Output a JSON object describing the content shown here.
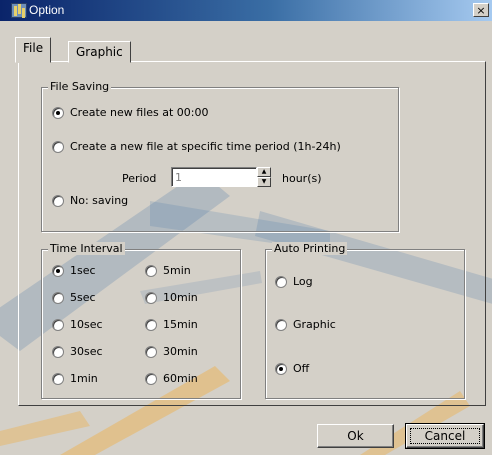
{
  "window": {
    "title": "Option",
    "close_glyph": "×"
  },
  "tabs": [
    {
      "label": "File",
      "active": true
    },
    {
      "label": "Graphic",
      "active": false
    }
  ],
  "file_saving": {
    "legend": "File Saving",
    "options": [
      {
        "label": "Create new files at 00:00",
        "checked": true
      },
      {
        "label": "Create a new file at specific time period (1h-24h)",
        "checked": false
      },
      {
        "label": "No: saving",
        "checked": false
      }
    ],
    "period_label": "Period",
    "period_value": "1",
    "period_unit": "hour(s)"
  },
  "time_interval": {
    "legend": "Time Interval",
    "options": [
      {
        "label": "1sec",
        "checked": true
      },
      {
        "label": "5sec",
        "checked": false
      },
      {
        "label": "10sec",
        "checked": false
      },
      {
        "label": "30sec",
        "checked": false
      },
      {
        "label": "1min",
        "checked": false
      },
      {
        "label": "5min",
        "checked": false
      },
      {
        "label": "10min",
        "checked": false
      },
      {
        "label": "15min",
        "checked": false
      },
      {
        "label": "30min",
        "checked": false
      },
      {
        "label": "60min",
        "checked": false
      }
    ]
  },
  "auto_printing": {
    "legend": "Auto Printing",
    "options": [
      {
        "label": "Log",
        "checked": false
      },
      {
        "label": "Graphic",
        "checked": false
      },
      {
        "label": "Off",
        "checked": true
      }
    ]
  },
  "buttons": {
    "ok": "Ok",
    "cancel": "Cancel"
  },
  "colors": {
    "face": "#d4d0c8",
    "title_start": "#0a246a",
    "title_end": "#a6caf0",
    "watermark_blue": "#3a6ea5",
    "watermark_orange": "#f5a623"
  }
}
